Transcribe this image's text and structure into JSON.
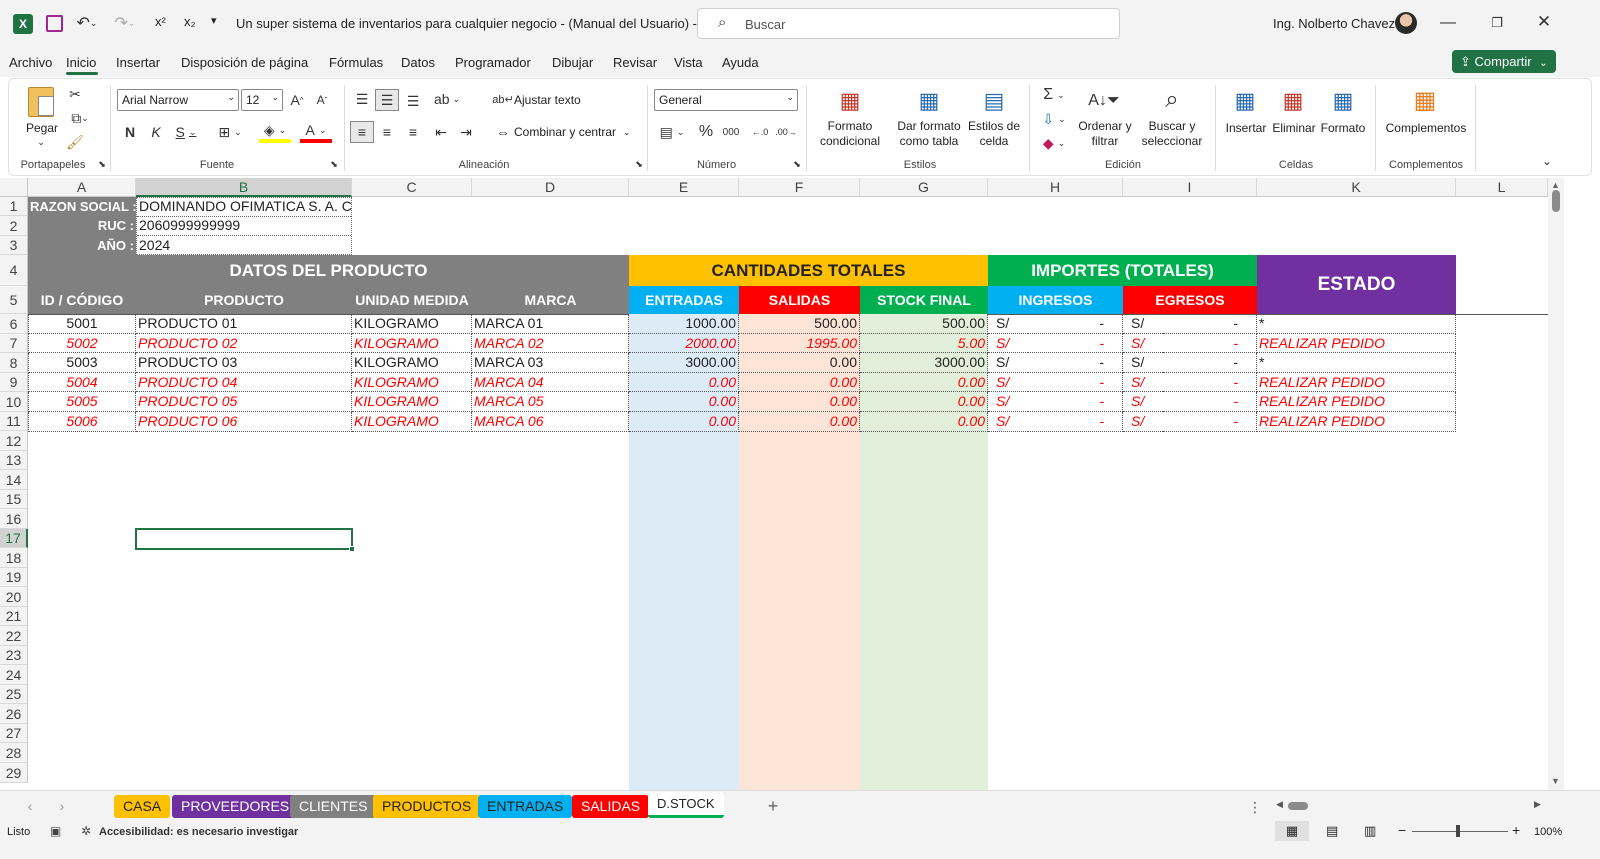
{
  "titlebar": {
    "document_title": "Un super sistema de inventarios para cualquier negocio - (Manual del Usuario)  -  E...",
    "search_placeholder": "Buscar",
    "user_name": "Ing. Nolberto Chavez",
    "superscript_label": "x²",
    "subscript_label": "x₂"
  },
  "menu": {
    "items": [
      "Archivo",
      "Inicio",
      "Insertar",
      "Disposición de página",
      "Fórmulas",
      "Datos",
      "Programador",
      "Dibujar",
      "Revisar",
      "Vista",
      "Ayuda"
    ],
    "active": "Inicio",
    "share_label": "Compartir"
  },
  "ribbon": {
    "paste_label": "Pegar",
    "font_name": "Arial Narrow",
    "font_size": "12",
    "wrap_text": "Ajustar texto",
    "merge_center": "Combinar y centrar",
    "number_format": "General",
    "cond_format_1": "Formato",
    "cond_format_2": "condicional",
    "format_table_1": "Dar formato",
    "format_table_2": "como tabla",
    "cell_styles_1": "Estilos de",
    "cell_styles_2": "celda",
    "sort_1": "Ordenar y",
    "sort_2": "filtrar",
    "find_1": "Buscar y",
    "find_2": "seleccionar",
    "insert": "Insertar",
    "delete": "Eliminar",
    "format": "Formato",
    "addins": "Complementos",
    "groups": {
      "clipboard": "Portapapeles",
      "font": "Fuente",
      "alignment": "Alineación",
      "number": "Número",
      "styles": "Estilos",
      "editing": "Edición",
      "cells": "Celdas",
      "addins": "Complementos"
    }
  },
  "sheet": {
    "columns": [
      "A",
      "B",
      "C",
      "D",
      "E",
      "F",
      "G",
      "H",
      "I",
      "K",
      "L"
    ],
    "rows": [
      "1",
      "2",
      "3",
      "4",
      "5",
      "6",
      "7",
      "8",
      "9",
      "10",
      "11",
      "12",
      "13",
      "14",
      "15",
      "16",
      "17",
      "18",
      "19",
      "20",
      "21",
      "22",
      "23",
      "24",
      "25",
      "26",
      "27",
      "28",
      "29"
    ],
    "info": {
      "razon_label": "RAZON SOCIAL :",
      "razon_value": "DOMINANDO OFIMATICA S. A. C.",
      "ruc_label": "RUC :",
      "ruc_value": "2060999999999",
      "ano_label": "AÑO :",
      "ano_value": "2024"
    },
    "headers": {
      "datos": "DATOS DEL PRODUCTO",
      "cantidades": "CANTIDADES TOTALES",
      "importes": "IMPORTES (TOTALES)",
      "estado": "ESTADO",
      "id": "ID / CÓDIGO",
      "producto": "PRODUCTO",
      "unidad": "UNIDAD MEDIDA",
      "marca": "MARCA",
      "entradas": "ENTRADAS",
      "salidas": "SALIDAS",
      "stock": "STOCK FINAL",
      "ingresos": "INGRESOS",
      "egresos": "EGRESOS"
    },
    "data_rows": [
      {
        "id": "5001",
        "producto": "PRODUCTO 01",
        "unidad": "KILOGRAMO",
        "marca": "MARCA 01",
        "entradas": "1000.00",
        "salidas": "500.00",
        "stock": "500.00",
        "ing_cur": "S/",
        "ing_val": "-",
        "egr_cur": "S/",
        "egr_val": "-",
        "estado": "*",
        "alert": false
      },
      {
        "id": "5002",
        "producto": "PRODUCTO 02",
        "unidad": "KILOGRAMO",
        "marca": "MARCA 02",
        "entradas": "2000.00",
        "salidas": "1995.00",
        "stock": "5.00",
        "ing_cur": "S/",
        "ing_val": "-",
        "egr_cur": "S/",
        "egr_val": "-",
        "estado": "REALIZAR PEDIDO",
        "alert": true
      },
      {
        "id": "5003",
        "producto": "PRODUCTO 03",
        "unidad": "KILOGRAMO",
        "marca": "MARCA 03",
        "entradas": "3000.00",
        "salidas": "0.00",
        "stock": "3000.00",
        "ing_cur": "S/",
        "ing_val": "-",
        "egr_cur": "S/",
        "egr_val": "-",
        "estado": "*",
        "alert": false
      },
      {
        "id": "5004",
        "producto": "PRODUCTO 04",
        "unidad": "KILOGRAMO",
        "marca": "MARCA 04",
        "entradas": "0.00",
        "salidas": "0.00",
        "stock": "0.00",
        "ing_cur": "S/",
        "ing_val": "-",
        "egr_cur": "S/",
        "egr_val": "-",
        "estado": "REALIZAR PEDIDO",
        "alert": true
      },
      {
        "id": "5005",
        "producto": "PRODUCTO 05",
        "unidad": "KILOGRAMO",
        "marca": "MARCA 05",
        "entradas": "0.00",
        "salidas": "0.00",
        "stock": "0.00",
        "ing_cur": "S/",
        "ing_val": "-",
        "egr_cur": "S/",
        "egr_val": "-",
        "estado": "REALIZAR PEDIDO",
        "alert": true
      },
      {
        "id": "5006",
        "producto": "PRODUCTO 06",
        "unidad": "KILOGRAMO",
        "marca": "MARCA 06",
        "entradas": "0.00",
        "salidas": "0.00",
        "stock": "0.00",
        "ing_cur": "S/",
        "ing_val": "-",
        "egr_cur": "S/",
        "egr_val": "-",
        "estado": "REALIZAR PEDIDO",
        "alert": true
      }
    ]
  },
  "tabs": [
    {
      "label": "CASA",
      "bg": "#ffc000",
      "fg": "#222222"
    },
    {
      "label": "PROVEEDORES",
      "bg": "#7030a0",
      "fg": "#ffffff"
    },
    {
      "label": "CLIENTES",
      "bg": "#808080",
      "fg": "#ffffff"
    },
    {
      "label": "PRODUCTOS",
      "bg": "#ffc000",
      "fg": "#222222"
    },
    {
      "label": "ENTRADAS",
      "bg": "#00b0f0",
      "fg": "#222222"
    },
    {
      "label": "SALIDAS",
      "bg": "#ff0000",
      "fg": "#ffffff"
    },
    {
      "label": "D.STOCK",
      "bg": "#ffffff",
      "fg": "#222222"
    }
  ],
  "status": {
    "ready": "Listo",
    "accessibility": "Accesibilidad: es necesario investigar",
    "zoom": "100%"
  },
  "colors": {
    "excel_green": "#217346",
    "header_gray": "#808080",
    "yellow": "#ffc000",
    "green": "#00b050",
    "purple": "#7030a0",
    "blue": "#00b0f0",
    "red": "#ff0000",
    "alert_text": "#ff0000"
  }
}
